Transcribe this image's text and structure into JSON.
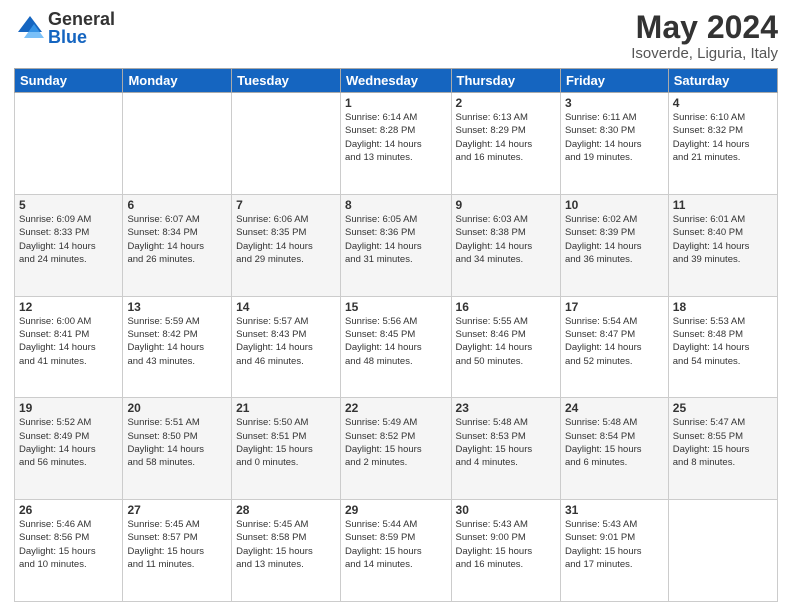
{
  "header": {
    "logo_general": "General",
    "logo_blue": "Blue",
    "month_title": "May 2024",
    "location": "Isoverde, Liguria, Italy"
  },
  "days_of_week": [
    "Sunday",
    "Monday",
    "Tuesday",
    "Wednesday",
    "Thursday",
    "Friday",
    "Saturday"
  ],
  "weeks": [
    [
      {
        "day": "",
        "info": ""
      },
      {
        "day": "",
        "info": ""
      },
      {
        "day": "",
        "info": ""
      },
      {
        "day": "1",
        "info": "Sunrise: 6:14 AM\nSunset: 8:28 PM\nDaylight: 14 hours\nand 13 minutes."
      },
      {
        "day": "2",
        "info": "Sunrise: 6:13 AM\nSunset: 8:29 PM\nDaylight: 14 hours\nand 16 minutes."
      },
      {
        "day": "3",
        "info": "Sunrise: 6:11 AM\nSunset: 8:30 PM\nDaylight: 14 hours\nand 19 minutes."
      },
      {
        "day": "4",
        "info": "Sunrise: 6:10 AM\nSunset: 8:32 PM\nDaylight: 14 hours\nand 21 minutes."
      }
    ],
    [
      {
        "day": "5",
        "info": "Sunrise: 6:09 AM\nSunset: 8:33 PM\nDaylight: 14 hours\nand 24 minutes."
      },
      {
        "day": "6",
        "info": "Sunrise: 6:07 AM\nSunset: 8:34 PM\nDaylight: 14 hours\nand 26 minutes."
      },
      {
        "day": "7",
        "info": "Sunrise: 6:06 AM\nSunset: 8:35 PM\nDaylight: 14 hours\nand 29 minutes."
      },
      {
        "day": "8",
        "info": "Sunrise: 6:05 AM\nSunset: 8:36 PM\nDaylight: 14 hours\nand 31 minutes."
      },
      {
        "day": "9",
        "info": "Sunrise: 6:03 AM\nSunset: 8:38 PM\nDaylight: 14 hours\nand 34 minutes."
      },
      {
        "day": "10",
        "info": "Sunrise: 6:02 AM\nSunset: 8:39 PM\nDaylight: 14 hours\nand 36 minutes."
      },
      {
        "day": "11",
        "info": "Sunrise: 6:01 AM\nSunset: 8:40 PM\nDaylight: 14 hours\nand 39 minutes."
      }
    ],
    [
      {
        "day": "12",
        "info": "Sunrise: 6:00 AM\nSunset: 8:41 PM\nDaylight: 14 hours\nand 41 minutes."
      },
      {
        "day": "13",
        "info": "Sunrise: 5:59 AM\nSunset: 8:42 PM\nDaylight: 14 hours\nand 43 minutes."
      },
      {
        "day": "14",
        "info": "Sunrise: 5:57 AM\nSunset: 8:43 PM\nDaylight: 14 hours\nand 46 minutes."
      },
      {
        "day": "15",
        "info": "Sunrise: 5:56 AM\nSunset: 8:45 PM\nDaylight: 14 hours\nand 48 minutes."
      },
      {
        "day": "16",
        "info": "Sunrise: 5:55 AM\nSunset: 8:46 PM\nDaylight: 14 hours\nand 50 minutes."
      },
      {
        "day": "17",
        "info": "Sunrise: 5:54 AM\nSunset: 8:47 PM\nDaylight: 14 hours\nand 52 minutes."
      },
      {
        "day": "18",
        "info": "Sunrise: 5:53 AM\nSunset: 8:48 PM\nDaylight: 14 hours\nand 54 minutes."
      }
    ],
    [
      {
        "day": "19",
        "info": "Sunrise: 5:52 AM\nSunset: 8:49 PM\nDaylight: 14 hours\nand 56 minutes."
      },
      {
        "day": "20",
        "info": "Sunrise: 5:51 AM\nSunset: 8:50 PM\nDaylight: 14 hours\nand 58 minutes."
      },
      {
        "day": "21",
        "info": "Sunrise: 5:50 AM\nSunset: 8:51 PM\nDaylight: 15 hours\nand 0 minutes."
      },
      {
        "day": "22",
        "info": "Sunrise: 5:49 AM\nSunset: 8:52 PM\nDaylight: 15 hours\nand 2 minutes."
      },
      {
        "day": "23",
        "info": "Sunrise: 5:48 AM\nSunset: 8:53 PM\nDaylight: 15 hours\nand 4 minutes."
      },
      {
        "day": "24",
        "info": "Sunrise: 5:48 AM\nSunset: 8:54 PM\nDaylight: 15 hours\nand 6 minutes."
      },
      {
        "day": "25",
        "info": "Sunrise: 5:47 AM\nSunset: 8:55 PM\nDaylight: 15 hours\nand 8 minutes."
      }
    ],
    [
      {
        "day": "26",
        "info": "Sunrise: 5:46 AM\nSunset: 8:56 PM\nDaylight: 15 hours\nand 10 minutes."
      },
      {
        "day": "27",
        "info": "Sunrise: 5:45 AM\nSunset: 8:57 PM\nDaylight: 15 hours\nand 11 minutes."
      },
      {
        "day": "28",
        "info": "Sunrise: 5:45 AM\nSunset: 8:58 PM\nDaylight: 15 hours\nand 13 minutes."
      },
      {
        "day": "29",
        "info": "Sunrise: 5:44 AM\nSunset: 8:59 PM\nDaylight: 15 hours\nand 14 minutes."
      },
      {
        "day": "30",
        "info": "Sunrise: 5:43 AM\nSunset: 9:00 PM\nDaylight: 15 hours\nand 16 minutes."
      },
      {
        "day": "31",
        "info": "Sunrise: 5:43 AM\nSunset: 9:01 PM\nDaylight: 15 hours\nand 17 minutes."
      },
      {
        "day": "",
        "info": ""
      }
    ]
  ]
}
